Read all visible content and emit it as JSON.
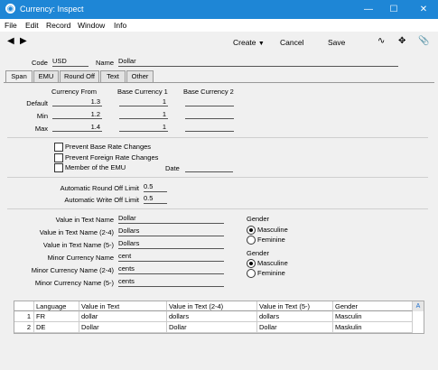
{
  "window": {
    "title": "Currency: Inspect"
  },
  "menu": {
    "file": "File",
    "edit": "Edit",
    "record": "Record",
    "window": "Window",
    "info": "Info"
  },
  "toolbar": {
    "create": "Create",
    "cancel": "Cancel",
    "save": "Save"
  },
  "header": {
    "code_label": "Code",
    "code_value": "USD",
    "name_label": "Name",
    "name_value": "Dollar"
  },
  "tabs": [
    "Span",
    "EMU",
    "Round Off",
    "Text",
    "Other"
  ],
  "span": {
    "col_from": "Currency From",
    "col_base1": "Base Currency 1",
    "col_base2": "Base Currency 2",
    "rows": [
      {
        "label": "Default",
        "from": "1.3",
        "base1": "1",
        "base2": ""
      },
      {
        "label": "Min",
        "from": "1.2",
        "base1": "1",
        "base2": ""
      },
      {
        "label": "Max",
        "from": "1.4",
        "base1": "1",
        "base2": ""
      }
    ]
  },
  "emu": {
    "prevent_base": "Prevent Base Rate Changes",
    "prevent_foreign": "Prevent Foreign Rate Changes",
    "member": "Member of the EMU",
    "date_label": "Date",
    "date_value": ""
  },
  "roundoff": {
    "auto_round_label": "Automatic Round Off Limit",
    "auto_round_value": "0.5",
    "auto_write_label": "Automatic Write Off Limit",
    "auto_write_value": "0.5"
  },
  "text": {
    "vt_label": "Value in Text Name",
    "vt_value": "Dollar",
    "vt24_label": "Value in Text Name (2-4)",
    "vt24_value": "Dollars",
    "vt5_label": "Value in Text Name (5-)",
    "vt5_value": "Dollars",
    "mc_label": "Minor Currency Name",
    "mc_value": "cent",
    "mc24_label": "Minor Currency Name (2-4)",
    "mc24_value": "cents",
    "mc5_label": "Minor Currency Name (5-)",
    "mc5_value": "cents",
    "gender_label": "Gender",
    "masculine": "Masculine",
    "feminine": "Feminine"
  },
  "grid": {
    "headers": [
      "Language",
      "Value in Text",
      "Value in Text (2-4)",
      "Value in Text (5-)",
      "Gender"
    ],
    "rows": [
      {
        "num": "1",
        "lang": "FR",
        "vt": "dollar",
        "vt24": "dollars",
        "vt5": "dollars",
        "gender": "Masculin"
      },
      {
        "num": "2",
        "lang": "DE",
        "vt": "Dollar",
        "vt24": "Dollar",
        "vt5": "Dollar",
        "gender": "Maskulin"
      }
    ],
    "scroll_label": "A"
  }
}
